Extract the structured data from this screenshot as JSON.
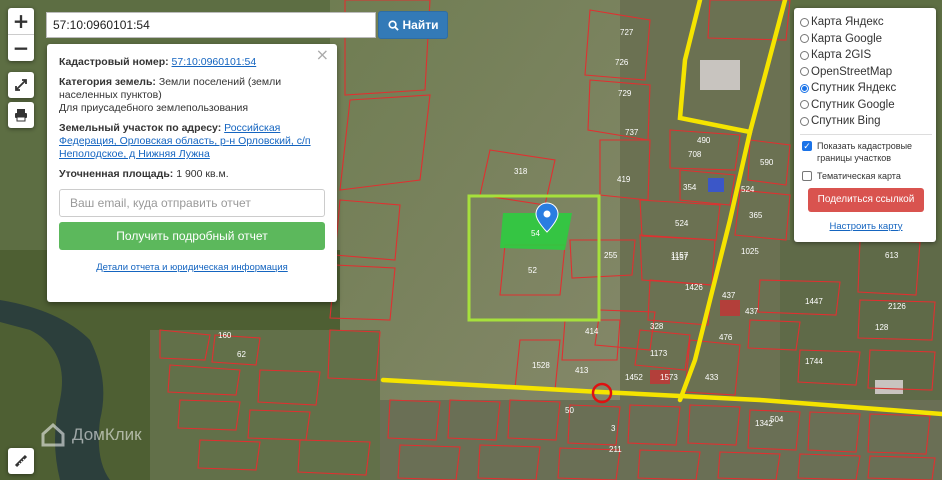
{
  "search": {
    "value": "57:10:0960101:54",
    "button_label": "Найти"
  },
  "zoom": {
    "in_label": "+",
    "out_label": "−"
  },
  "popup": {
    "cad_label": "Кадастровый номер:",
    "cad_value": "57:10:0960101:54",
    "category_label": "Категория земель:",
    "category_value": "Земли поселений (земли населенных пунктов)",
    "use_value": "Для приусадебного землепользования",
    "address_label": "Земельный участок по адресу:",
    "address_value": "Российская Федерация, Орловская область, р-н Орловский, с/п Неполодское, д Нижняя Лужна",
    "area_label": "Уточненная площадь:",
    "area_value": "1 900 кв.м.",
    "email_placeholder": "Ваш email, куда отправить отчет",
    "report_button": "Получить подробный отчет",
    "details_link": "Детали отчета и юридическая информация",
    "close_label": "×"
  },
  "layers": {
    "options": [
      {
        "label": "Карта Яндекс",
        "selected": false
      },
      {
        "label": "Карта Google",
        "selected": false
      },
      {
        "label": "Карта 2GIS",
        "selected": false
      },
      {
        "label": "OpenStreetMap",
        "selected": false
      },
      {
        "label": "Спутник Яндекс",
        "selected": true
      },
      {
        "label": "Спутник Google",
        "selected": false
      },
      {
        "label": "Спутник Bing",
        "selected": false
      }
    ],
    "show_cadastral": "Показать кадастровые границы участков",
    "show_cadastral_checked": true,
    "thematic": "Тематическая карта",
    "thematic_checked": false,
    "share_button": "Поделиться ссылкой",
    "setup_link": "Настроить карту"
  },
  "watermark": "ДомКлик",
  "map": {
    "selected_parcel_label": "54",
    "parcel_labels": [
      "727",
      "726",
      "729",
      "737",
      "419",
      "318",
      "52",
      "255",
      "1157",
      "1426",
      "708",
      "490",
      "354",
      "524",
      "524",
      "590",
      "365",
      "1025",
      "1157",
      "328",
      "1173",
      "413",
      "414",
      "433",
      "437",
      "1447",
      "2126",
      "613",
      "128",
      "504",
      "1744",
      "160",
      "62",
      "3",
      "50",
      "211",
      "1528",
      "1452",
      "1573",
      "476",
      "437",
      "1342"
    ],
    "colors": {
      "cadastral": "#e03030",
      "highlight": "#a6e03c",
      "selected": "#2ecc40",
      "road": "#f5e400",
      "marker": "#2a7de1",
      "circle": "#e01010"
    }
  }
}
